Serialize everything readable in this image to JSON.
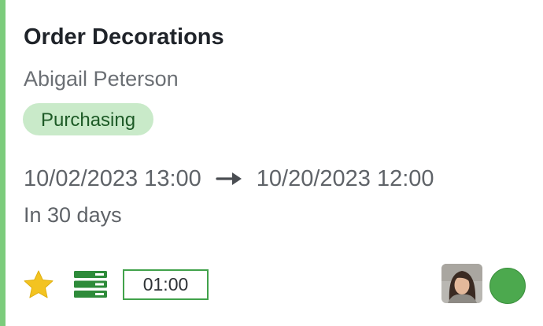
{
  "task": {
    "title": "Order Decorations",
    "assignee": "Abigail Peterson",
    "stage": "Purchasing",
    "start": "10/02/2023 13:00",
    "end": "10/20/2023 12:00",
    "relative_deadline": "In 30 days",
    "timer": "01:00",
    "starred": true,
    "status_color": "#4ca94e"
  },
  "colors": {
    "accent": "#7ccc7c",
    "tag_bg": "#c9eac9",
    "tag_text": "#1d5a26",
    "star": "#f3c321",
    "icon_green": "#2e8b3a"
  },
  "icons": {
    "favorite": "star-icon",
    "subtasks": "list-icon",
    "arrow": "arrow-right-icon"
  }
}
